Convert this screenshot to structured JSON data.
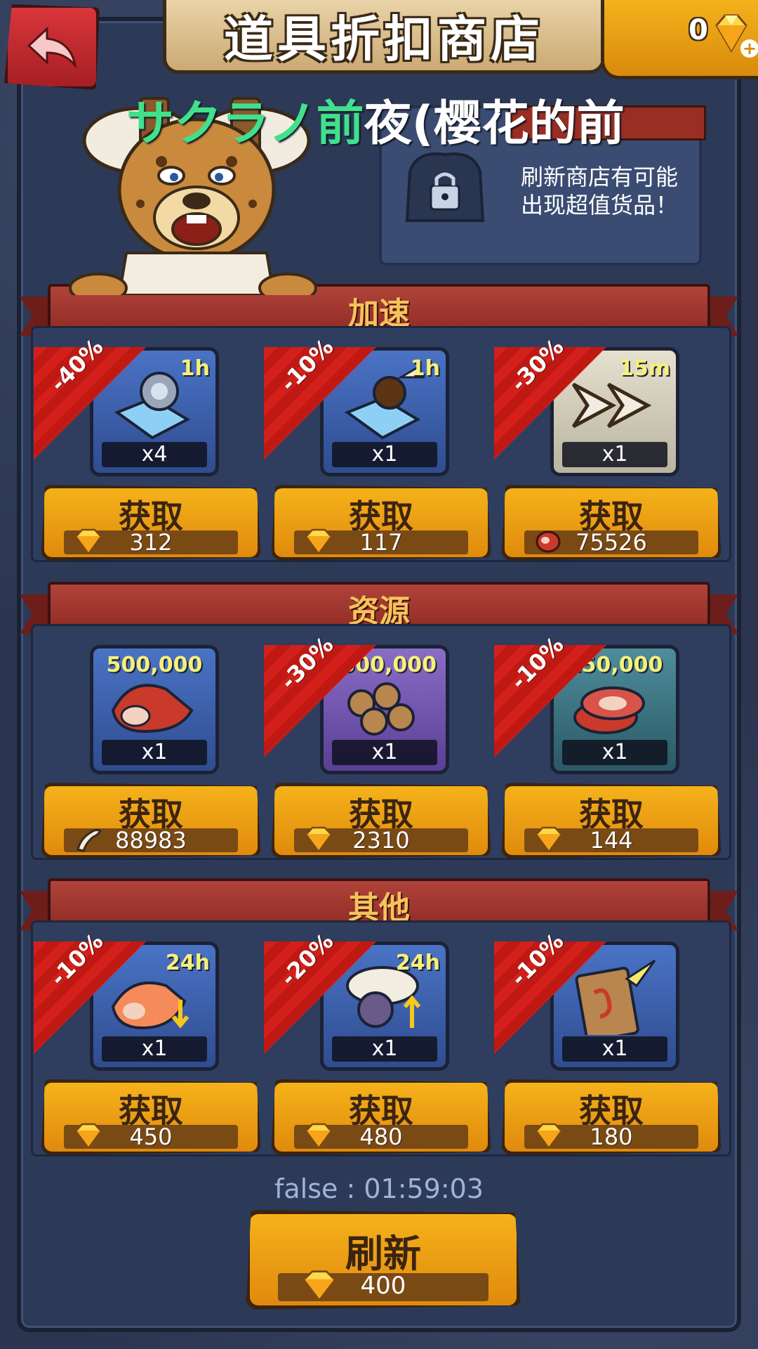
{
  "header": {
    "title": "道具折扣商店",
    "gems_count": "0"
  },
  "overlay_caption": {
    "green_part": "サクラノ",
    "green_char2": "前",
    "white_part": "夜(樱花的前"
  },
  "tip": {
    "line1": "刷新商店有可能",
    "line2": "出现超值货品！"
  },
  "sections": [
    {
      "label": "加速",
      "items": [
        {
          "discount": "-40%",
          "duration": "1h",
          "amount": "",
          "qty": "x4",
          "buy_label": "获取",
          "currency": "gem",
          "price": "312"
        },
        {
          "discount": "-10%",
          "duration": "1h",
          "amount": "",
          "qty": "x1",
          "buy_label": "获取",
          "currency": "gem",
          "price": "117"
        },
        {
          "discount": "-30%",
          "duration": "15m",
          "amount": "",
          "qty": "x1",
          "buy_label": "获取",
          "currency": "meat",
          "price": "75526"
        }
      ]
    },
    {
      "label": "资源",
      "items": [
        {
          "discount": "",
          "duration": "",
          "amount": "500,000",
          "qty": "x1",
          "buy_label": "获取",
          "currency": "bone",
          "price": "88983"
        },
        {
          "discount": "-30%",
          "duration": "",
          "amount": ",500,000",
          "qty": "x1",
          "buy_label": "获取",
          "currency": "gem",
          "price": "2310"
        },
        {
          "discount": "-10%",
          "duration": "",
          "amount": "150,000",
          "qty": "x1",
          "buy_label": "获取",
          "currency": "gem",
          "price": "144"
        }
      ]
    },
    {
      "label": "其他",
      "items": [
        {
          "discount": "-10%",
          "duration": "24h",
          "amount": "",
          "qty": "x1",
          "buy_label": "获取",
          "currency": "gem",
          "price": "450"
        },
        {
          "discount": "-20%",
          "duration": "24h",
          "amount": "",
          "qty": "x1",
          "buy_label": "获取",
          "currency": "gem",
          "price": "480"
        },
        {
          "discount": "-10%",
          "duration": "",
          "amount": "",
          "qty": "x1",
          "buy_label": "获取",
          "currency": "gem",
          "price": "180"
        }
      ]
    }
  ],
  "timer": "false : 01:59:03",
  "refresh": {
    "label": "刷新",
    "price": "400"
  }
}
